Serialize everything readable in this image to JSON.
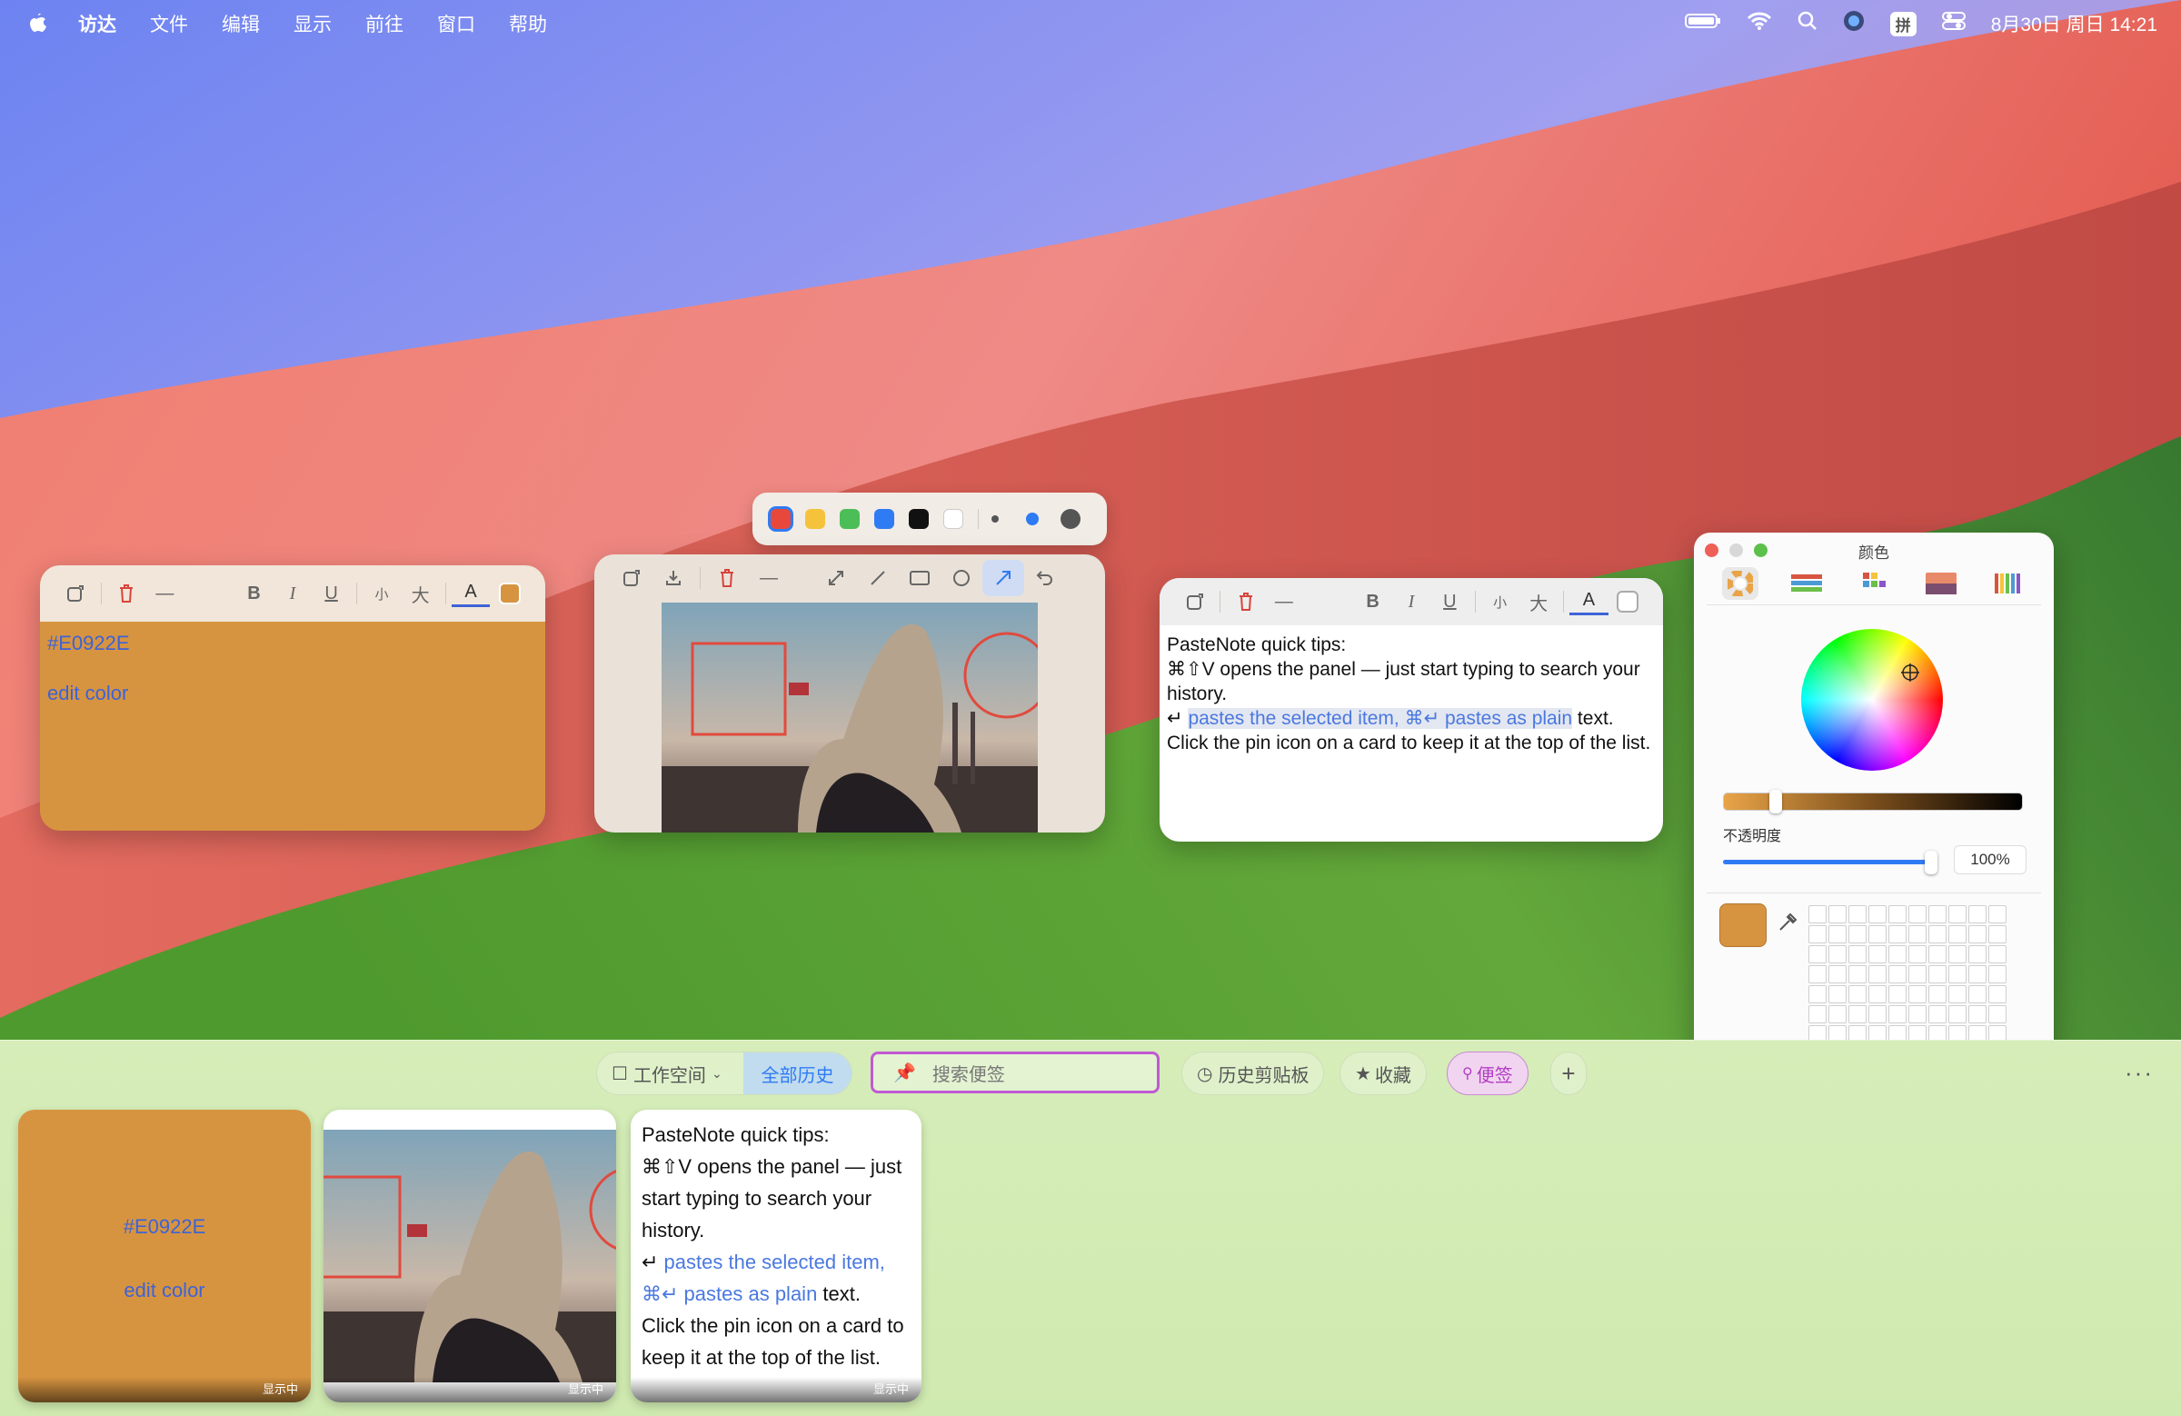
{
  "menubar": {
    "items": [
      "访达",
      "文件",
      "编辑",
      "显示",
      "前往",
      "窗口",
      "帮助"
    ],
    "ime": "拼",
    "datetime": "8月30日 周日  14:21"
  },
  "note_color": {
    "text1": "#E0922E",
    "text2": "edit color",
    "toolbar": {
      "small": "小",
      "large": "大",
      "bold": "B",
      "italic": "I",
      "underline": "U",
      "font": "A"
    }
  },
  "note_text": {
    "line1": "PasteNote quick tips:",
    "line2": "⌘⇧V opens the panel — just start typing to search your history.",
    "line3_prefix": "↵ ",
    "line3_hl": "pastes the selected item, ⌘↵ pastes as plain",
    "line3_suffix": " text.",
    "line4": "Click the pin icon on a card to keep it at the top of the list.",
    "toolbar": {
      "small": "小",
      "large": "大",
      "bold": "B",
      "italic": "I",
      "underline": "U",
      "font": "A"
    }
  },
  "palette": {
    "colors": [
      "#e8483b",
      "#f5c33b",
      "#4cbe57",
      "#2f7bf4",
      "#111111",
      "#ffffff"
    ]
  },
  "color_panel": {
    "title": "颜色",
    "opacity_label": "不透明度",
    "opacity_value": "100%",
    "current_color": "#d79440"
  },
  "panel": {
    "workspace": "工作空间",
    "all_history": "全部历史",
    "search_placeholder": "搜索便签",
    "clipboard": "历史剪贴板",
    "favorites": "收藏",
    "notes": "便签",
    "add": "+",
    "more": "···",
    "badge": "显示中",
    "card1": {
      "line1": "#E0922E",
      "line2": "edit color"
    },
    "card3": {
      "line1": "PasteNote quick tips:",
      "line2": "⌘⇧V opens the panel — just start typing to search your history.",
      "arrow": "↵ ",
      "hl1": "pastes the selected item, ⌘↵ pastes as plain",
      "suffix": " text.",
      "line4": "Click the pin icon on a card to keep it at the top of the list."
    }
  }
}
